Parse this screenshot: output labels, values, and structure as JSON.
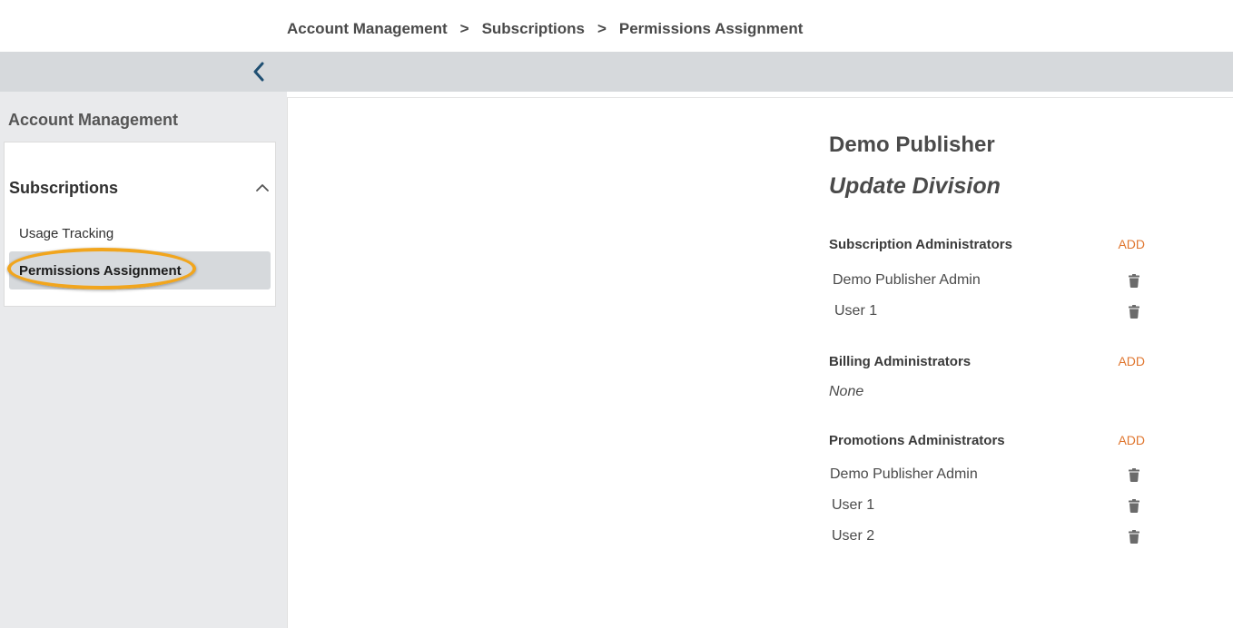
{
  "breadcrumb": {
    "items": [
      "Account Management",
      "Subscriptions",
      "Permissions Assignment"
    ],
    "separator": ">"
  },
  "sidebar": {
    "title": "Account Management",
    "section": {
      "label": "Subscriptions",
      "items": [
        {
          "label": "Usage Tracking"
        },
        {
          "label": "Permissions Assignment"
        }
      ]
    }
  },
  "panel": {
    "publisher": "Demo Publisher",
    "subtitle": "Update Division",
    "add_label": "ADD",
    "groups": [
      {
        "title": "Subscription Administrators",
        "members": [
          "Demo Publisher Admin",
          "User 1"
        ]
      },
      {
        "title": "Billing Administrators",
        "empty_text": "None"
      },
      {
        "title": "Promotions Administrators",
        "members": [
          "Demo Publisher Admin",
          "User 1",
          "User 2"
        ]
      }
    ]
  },
  "colors": {
    "accent": "#e0762f",
    "highlight": "#f1a51d",
    "chevron": "#1f4f72"
  }
}
